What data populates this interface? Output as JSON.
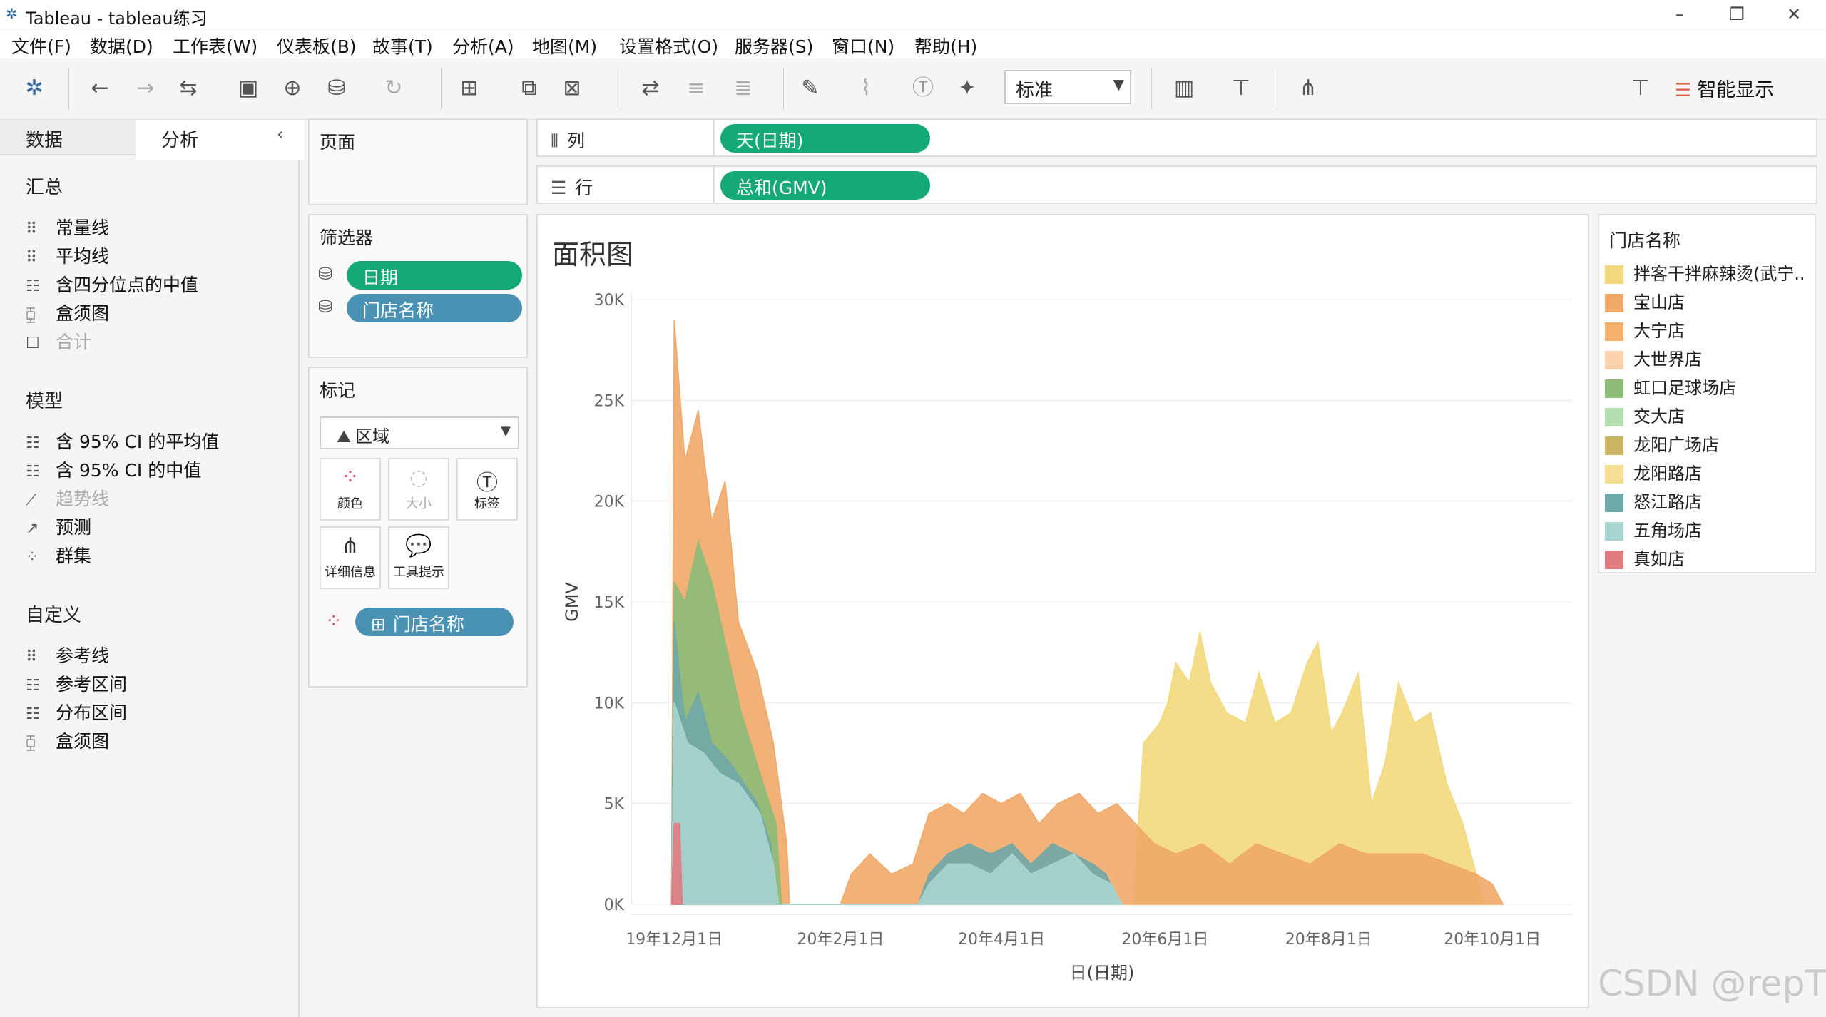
{
  "window": {
    "title": "Tableau - tableau练习"
  },
  "menu": [
    "文件(F)",
    "数据(D)",
    "工作表(W)",
    "仪表板(B)",
    "故事(T)",
    "分析(A)",
    "地图(M)",
    "设置格式(O)",
    "服务器(S)",
    "窗口(N)",
    "帮助(H)"
  ],
  "toolbar": {
    "fit_select": "标准",
    "smart_show": "智能显示"
  },
  "left_panel": {
    "tabs": [
      "数据",
      "分析"
    ],
    "sections": [
      {
        "title": "汇总",
        "items": [
          {
            "label": "常量线",
            "enabled": true
          },
          {
            "label": "平均线",
            "enabled": true
          },
          {
            "label": "含四分位点的中值",
            "enabled": true
          },
          {
            "label": "盒须图",
            "enabled": true
          },
          {
            "label": "合计",
            "enabled": false
          }
        ]
      },
      {
        "title": "模型",
        "items": [
          {
            "label": "含 95% CI 的平均值",
            "enabled": true
          },
          {
            "label": "含 95% CI 的中值",
            "enabled": true
          },
          {
            "label": "趋势线",
            "enabled": false
          },
          {
            "label": "预测",
            "enabled": true
          },
          {
            "label": "群集",
            "enabled": true
          }
        ]
      },
      {
        "title": "自定义",
        "items": [
          {
            "label": "参考线",
            "enabled": true
          },
          {
            "label": "参考区间",
            "enabled": true
          },
          {
            "label": "分布区间",
            "enabled": true
          },
          {
            "label": "盒须图",
            "enabled": true
          }
        ]
      }
    ]
  },
  "pages_card": {
    "title": "页面"
  },
  "filters_card": {
    "title": "筛选器",
    "pills": [
      "日期",
      "门店名称"
    ]
  },
  "marks_card": {
    "title": "标记",
    "type": "区域",
    "buttons": [
      {
        "label": "颜色",
        "enabled": true
      },
      {
        "label": "大小",
        "enabled": false
      },
      {
        "label": "标签",
        "enabled": true
      },
      {
        "label": "详细信息",
        "enabled": true
      },
      {
        "label": "工具提示",
        "enabled": true
      }
    ],
    "color_pill": "门店名称"
  },
  "shelves": {
    "columns_label": "列",
    "columns_pill": "天(日期)",
    "rows_label": "行",
    "rows_pill": "总和(GMV)"
  },
  "sheet": {
    "title": "面积图"
  },
  "legend": {
    "title": "门店名称",
    "items": [
      {
        "label": "拌客干拌麻辣烫(武宁..",
        "color": "#f3d97c"
      },
      {
        "label": "宝山店",
        "color": "#f0a868"
      },
      {
        "label": "大宁店",
        "color": "#f4b06c"
      },
      {
        "label": "大世界店",
        "color": "#fad3ad"
      },
      {
        "label": "虹口足球场店",
        "color": "#8cbc78"
      },
      {
        "label": "交大店",
        "color": "#b4deb0"
      },
      {
        "label": "龙阳广场店",
        "color": "#cbb463"
      },
      {
        "label": "龙阳路店",
        "color": "#f5de94"
      },
      {
        "label": "怒江路店",
        "color": "#6fa8a8"
      },
      {
        "label": "五角场店",
        "color": "#a8d4d0"
      },
      {
        "label": "真如店",
        "color": "#e27b80"
      }
    ]
  },
  "chart_data": {
    "type": "area",
    "xlabel": "日(日期)",
    "ylabel": "GMV",
    "x_ticks": [
      "19年12月1日",
      "20年2月1日",
      "20年4月1日",
      "20年6月1日",
      "20年8月1日",
      "20年10月1日"
    ],
    "y_ticks": [
      "0K",
      "5K",
      "10K",
      "15K",
      "20K",
      "25K",
      "30K"
    ],
    "ylim": [
      0,
      30000
    ],
    "xlim": [
      "2019-11-15",
      "2020-10-31"
    ],
    "grid": "horizontal",
    "stacked": false,
    "series": [
      {
        "name": "拌客干拌麻辣烫(武宁..",
        "color": "#f3d97c",
        "points": [
          [
            "2020-05-20",
            0
          ],
          [
            "2020-05-24",
            8000
          ],
          [
            "2020-05-30",
            9000
          ],
          [
            "2020-06-02",
            10000
          ],
          [
            "2020-06-05",
            12000
          ],
          [
            "2020-06-10",
            11000
          ],
          [
            "2020-06-14",
            13500
          ],
          [
            "2020-06-18",
            11000
          ],
          [
            "2020-06-24",
            9500
          ],
          [
            "2020-07-01",
            9000
          ],
          [
            "2020-07-06",
            11500
          ],
          [
            "2020-07-12",
            9000
          ],
          [
            "2020-07-18",
            9500
          ],
          [
            "2020-07-24",
            12000
          ],
          [
            "2020-07-28",
            13000
          ],
          [
            "2020-08-02",
            8500
          ],
          [
            "2020-08-06",
            9500
          ],
          [
            "2020-08-12",
            11500
          ],
          [
            "2020-08-17",
            5000
          ],
          [
            "2020-08-22",
            7000
          ],
          [
            "2020-08-27",
            11000
          ],
          [
            "2020-09-02",
            9000
          ],
          [
            "2020-09-08",
            9500
          ],
          [
            "2020-09-14",
            6000
          ],
          [
            "2020-09-20",
            4000
          ],
          [
            "2020-09-24",
            2000
          ],
          [
            "2020-09-28",
            0
          ]
        ]
      },
      {
        "name": "宝山店",
        "color": "#f0a868",
        "points": [
          [
            "2019-11-30",
            0
          ],
          [
            "2019-12-01",
            29000
          ],
          [
            "2019-12-05",
            22000
          ],
          [
            "2019-12-10",
            24500
          ],
          [
            "2019-12-15",
            19000
          ],
          [
            "2019-12-20",
            21000
          ],
          [
            "2019-12-25",
            14000
          ],
          [
            "2020-01-01",
            11500
          ],
          [
            "2020-01-07",
            8000
          ],
          [
            "2020-01-12",
            3000
          ],
          [
            "2020-01-13",
            0
          ],
          [
            "2020-01-15",
            0
          ],
          [
            "2020-01-16",
            0
          ],
          [
            "2020-02-01",
            0
          ],
          [
            "2020-02-05",
            1500
          ],
          [
            "2020-02-12",
            2500
          ],
          [
            "2020-02-20",
            1500
          ],
          [
            "2020-02-28",
            2000
          ],
          [
            "2020-03-05",
            4500
          ],
          [
            "2020-03-12",
            5000
          ],
          [
            "2020-03-18",
            4500
          ],
          [
            "2020-03-25",
            5500
          ],
          [
            "2020-04-01",
            5000
          ],
          [
            "2020-04-08",
            5500
          ],
          [
            "2020-04-15",
            4000
          ],
          [
            "2020-04-22",
            5000
          ],
          [
            "2020-04-30",
            5500
          ],
          [
            "2020-05-07",
            4500
          ],
          [
            "2020-05-14",
            5000
          ],
          [
            "2020-05-21",
            4000
          ],
          [
            "2020-05-28",
            3000
          ],
          [
            "2020-06-05",
            2500
          ],
          [
            "2020-06-15",
            3000
          ],
          [
            "2020-06-25",
            2000
          ],
          [
            "2020-07-05",
            3000
          ],
          [
            "2020-07-15",
            2500
          ],
          [
            "2020-07-25",
            2000
          ],
          [
            "2020-08-05",
            3000
          ],
          [
            "2020-08-15",
            2500
          ],
          [
            "2020-08-25",
            2500
          ],
          [
            "2020-09-05",
            2500
          ],
          [
            "2020-09-15",
            2000
          ],
          [
            "2020-09-25",
            1500
          ],
          [
            "2020-10-01",
            1000
          ],
          [
            "2020-10-05",
            0
          ]
        ]
      },
      {
        "name": "虹口足球场店",
        "color": "#8cbc78",
        "points": [
          [
            "2019-11-30",
            0
          ],
          [
            "2019-12-01",
            16000
          ],
          [
            "2019-12-05",
            15000
          ],
          [
            "2019-12-10",
            18000
          ],
          [
            "2019-12-15",
            16000
          ],
          [
            "2019-12-20",
            13000
          ],
          [
            "2019-12-26",
            9500
          ],
          [
            "2020-01-02",
            6500
          ],
          [
            "2020-01-08",
            4000
          ],
          [
            "2020-01-10",
            0
          ]
        ]
      },
      {
        "name": "怒江路店",
        "color": "#6fa8a8",
        "points": [
          [
            "2019-11-30",
            0
          ],
          [
            "2019-12-01",
            14000
          ],
          [
            "2019-12-05",
            9000
          ],
          [
            "2019-12-10",
            10500
          ],
          [
            "2019-12-15",
            8000
          ],
          [
            "2019-12-22",
            7000
          ],
          [
            "2020-01-01",
            5000
          ],
          [
            "2020-01-06",
            3000
          ],
          [
            "2020-01-08",
            0
          ],
          [
            "2020-03-01",
            0
          ],
          [
            "2020-03-05",
            1500
          ],
          [
            "2020-03-12",
            2500
          ],
          [
            "2020-03-20",
            3000
          ],
          [
            "2020-03-28",
            2500
          ],
          [
            "2020-04-05",
            3000
          ],
          [
            "2020-04-12",
            2000
          ],
          [
            "2020-04-20",
            3000
          ],
          [
            "2020-04-28",
            2500
          ],
          [
            "2020-05-05",
            2000
          ],
          [
            "2020-05-10",
            1500
          ],
          [
            "2020-05-15",
            0
          ]
        ]
      },
      {
        "name": "五角场店",
        "color": "#a8d4d0",
        "points": [
          [
            "2019-11-30",
            0
          ],
          [
            "2019-12-01",
            10000
          ],
          [
            "2019-12-06",
            8000
          ],
          [
            "2019-12-12",
            7500
          ],
          [
            "2019-12-18",
            6500
          ],
          [
            "2019-12-25",
            6000
          ],
          [
            "2020-01-02",
            4500
          ],
          [
            "2020-01-07",
            2000
          ],
          [
            "2020-01-09",
            0
          ],
          [
            "2020-03-01",
            0
          ],
          [
            "2020-03-05",
            1000
          ],
          [
            "2020-03-12",
            2000
          ],
          [
            "2020-03-20",
            2000
          ],
          [
            "2020-03-28",
            1500
          ],
          [
            "2020-04-05",
            2500
          ],
          [
            "2020-04-12",
            1500
          ],
          [
            "2020-04-20",
            2000
          ],
          [
            "2020-04-28",
            2500
          ],
          [
            "2020-05-05",
            1500
          ],
          [
            "2020-05-12",
            1000
          ],
          [
            "2020-05-16",
            0
          ]
        ]
      },
      {
        "name": "真如店",
        "color": "#e27b80",
        "points": [
          [
            "2019-11-30",
            0
          ],
          [
            "2019-12-01",
            4000
          ],
          [
            "2019-12-03",
            4000
          ],
          [
            "2019-12-04",
            0
          ]
        ]
      }
    ]
  }
}
